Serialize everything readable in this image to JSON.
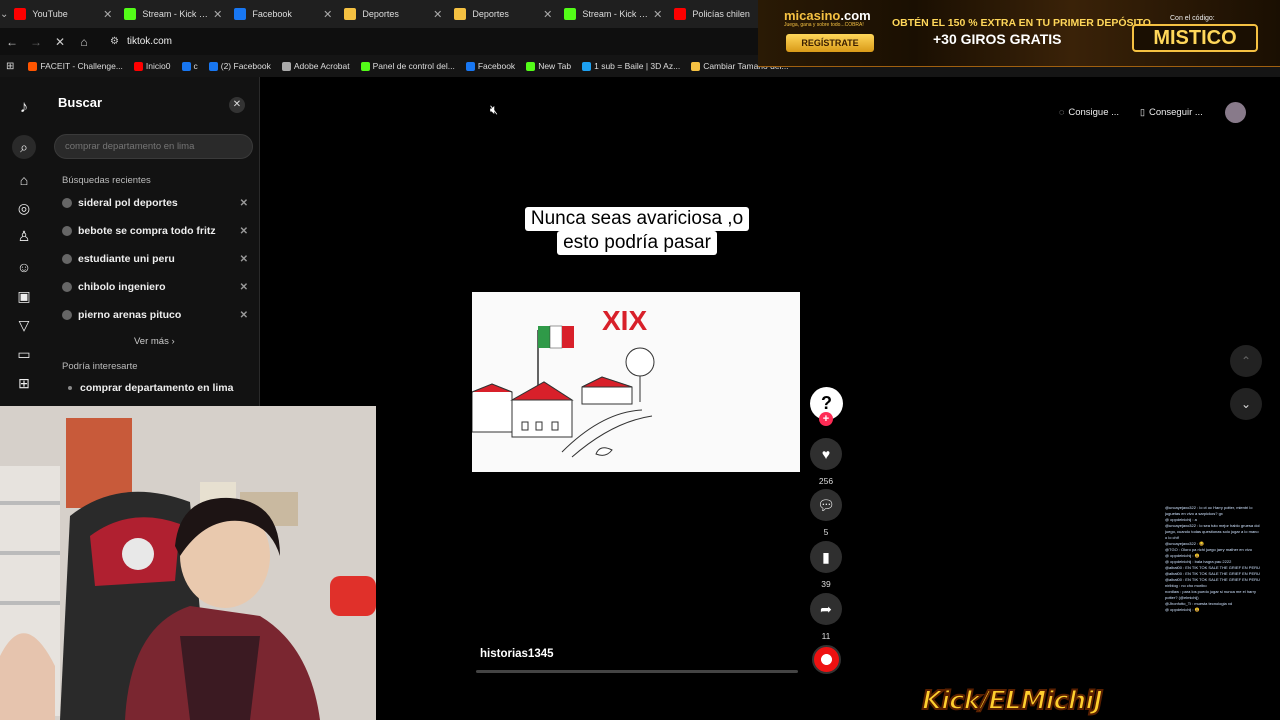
{
  "browser": {
    "tabs": [
      {
        "label": "YouTube",
        "color": "#ff0000"
      },
      {
        "label": "Stream - Kick Das",
        "color": "#53fc18"
      },
      {
        "label": "Facebook",
        "color": "#1877f2"
      },
      {
        "label": "Deportes",
        "color": "#f5c142"
      },
      {
        "label": "Deportes",
        "color": "#f5c142"
      },
      {
        "label": "Stream - Kick Das",
        "color": "#53fc18"
      },
      {
        "label": "Policías chilen",
        "color": "#ff0000"
      }
    ],
    "url": "tiktok.com",
    "bookmarks": [
      {
        "label": "FACEIT - Challenge...",
        "color": "#ff5500"
      },
      {
        "label": "Inicio0",
        "color": "#ff0000"
      },
      {
        "label": "c",
        "color": "#1877f2"
      },
      {
        "label": "(2) Facebook",
        "color": "#1877f2"
      },
      {
        "label": "Adobe Acrobat",
        "color": "#aaaaaa"
      },
      {
        "label": "Panel de control del...",
        "color": "#53fc18"
      },
      {
        "label": "Facebook",
        "color": "#1877f2"
      },
      {
        "label": "New Tab",
        "color": "#53fc18"
      },
      {
        "label": "1 sub = Baile | 3D Az...",
        "color": "#1da1f2"
      },
      {
        "label": "Cambiar Tamaño del...",
        "color": "#f5c142"
      }
    ]
  },
  "ad": {
    "logo": "micasino",
    "logo_suffix": ".com",
    "tagline": "Juega, gana y sobre todo...COBRA!",
    "cta": "REGÍSTRATE",
    "offer_line1": "OBTÉN EL 150 % EXTRA EN TU PRIMER DEPÓSITO",
    "offer_line2": "+30 GIROS GRATIS",
    "code_label": "Con el código:",
    "code": "MISTICO"
  },
  "rail_icons": [
    "tiktok-logo-icon",
    "search-icon",
    "home-icon",
    "explore-icon",
    "following-icon",
    "friends-icon",
    "live-icon",
    "upload-icon",
    "messages-icon",
    "add-icon"
  ],
  "search": {
    "title": "Buscar",
    "placeholder": "comprar departamento en lima",
    "recent_title": "Búsquedas recientes",
    "recent": [
      "sideral pol deportes",
      "bebote se compra todo fritz",
      "estudiante uni peru",
      "chibolo ingeniero",
      "pierno arenas pituco"
    ],
    "more": "Ver más",
    "suggest_title": "Podría interesarte",
    "suggest": [
      "comprar departamento en lima"
    ]
  },
  "video": {
    "caption_line1": "Nunca seas avariciosa ,o",
    "caption_line2": "esto podría pasar",
    "frame_text": "XIX",
    "username": "historias1345",
    "progress": 0.0
  },
  "actions": {
    "likes": "256",
    "comments": "5",
    "saves": "39",
    "shares": "11"
  },
  "topright": {
    "btn1": "Consigue ...",
    "btn2": "Conseguir ..."
  },
  "chat": [
    "@uncayejaxo322 : lo ct oc Harry potter, mientri lo",
    "juguetas en vivo a sarpickos? gx",
    "@ oppdelnichij : a",
    "@uncayejaxo322 : lo sea tuto mejor hablo gruesa dol",
    "juego, cuando todas questionas solo jugar a lo mano",
    "o lo chif",
    "@uncayejaxo322 : 😃",
    "@TGO : Oloro pa richi juego jarry mather en vivo",
    "@ oppdelnichij : 😃",
    "@ oppdelnichij : bala hagra pau 2222",
    "@albal00 : EN TIK TOK SALE THE GRIEF EN PERU",
    "@albal00 : EN TIK TOK SALE THE GRIEF EN PERU",
    "@albal00 : EN TIK TOK SALE THE GRIEF EN PERU",
    "niriblog : no cho moribo",
    "nordlaw : para los puedo jugar si nunca me el harry",
    "potter? (@elmichij)",
    "@Jhonfotto_Ti : muesta tecnologia xd",
    "@ oppdelnichij : 😃"
  ],
  "streamer_logo": "Kick/ELMichiJ"
}
